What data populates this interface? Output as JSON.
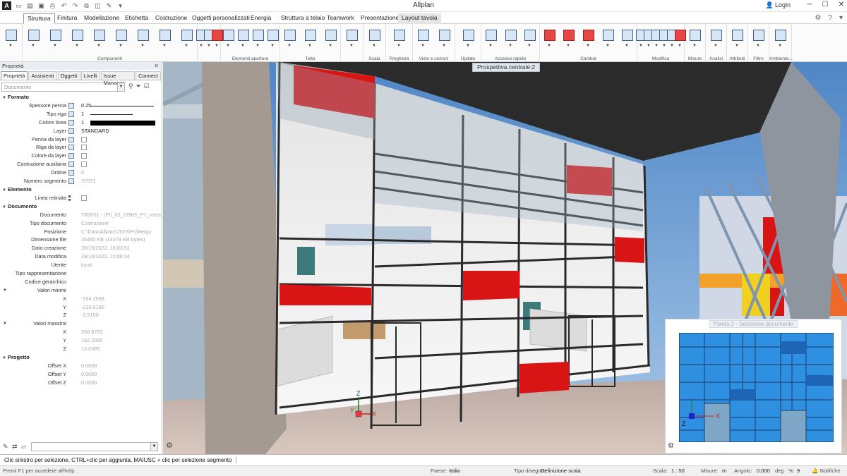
{
  "app": {
    "title": "Allplan",
    "logo": "A",
    "login": "Login"
  },
  "tabs": [
    {
      "label": "Struttura",
      "active": true
    },
    {
      "label": "Finitura"
    },
    {
      "label": "Modellazione"
    },
    {
      "label": "Etichetta"
    },
    {
      "label": "Costruzione"
    },
    {
      "label": "Oggetti personalizzati"
    },
    {
      "label": "Energia"
    },
    {
      "label": "Struttura a telaio"
    },
    {
      "label": "Teamwork"
    },
    {
      "label": "Presentazione"
    },
    {
      "label": "Layout tavola"
    }
  ],
  "ribbon_groups": [
    {
      "label": "",
      "icons": [
        "layers-icon"
      ]
    },
    {
      "label": "Componenti",
      "icons": [
        "wall-icon",
        "slab-icon",
        "beam-icon",
        "column-icon",
        "foundation-icon",
        "stair-icon",
        "beam-frame-icon",
        "column-frame-icon"
      ]
    },
    {
      "label": "",
      "icons": [
        "room-icon",
        "bar-chart-icon",
        "delete-red-icon"
      ]
    },
    {
      "label": "Elementi apertura",
      "icons": [
        "window-icon",
        "door-icon",
        "opening-icon",
        "niche-icon"
      ]
    },
    {
      "label": "Tetto",
      "icons": [
        "roof-icon",
        "roof2-icon",
        "roof3-icon"
      ]
    },
    {
      "label": "",
      "icons": [
        "roof-edit-icon"
      ]
    },
    {
      "label": "Scala",
      "icons": [
        "stair2-icon"
      ]
    },
    {
      "label": "Ringhiera",
      "icons": [
        "railing-icon"
      ]
    },
    {
      "label": "Viste e sezioni",
      "icons": [
        "house-view-icon",
        "section-icon"
      ]
    },
    {
      "label": "Update",
      "icons": [
        "update-icon"
      ]
    },
    {
      "label": "Accesso rapido",
      "icons": [
        "line-icon",
        "text-icon",
        "dimension-icon"
      ]
    },
    {
      "label": "Cambia",
      "icons": [
        "pencil-icon",
        "modify-icon",
        "stretch-icon",
        "convert-icon",
        "replace-icon"
      ]
    },
    {
      "label": "Modifica",
      "icons": [
        "copy-icon",
        "move-icon",
        "rotate-icon",
        "mirror-icon",
        "scale-icon",
        "delete-icon"
      ]
    },
    {
      "label": "Misure",
      "icons": [
        "measure-icon"
      ]
    },
    {
      "label": "Analisi",
      "icons": [
        "abc-icon"
      ]
    },
    {
      "label": "Attributi",
      "icons": [
        "attributes-icon"
      ]
    },
    {
      "label": "Filtro",
      "icons": [
        "filter-icon"
      ]
    },
    {
      "label": "Ambiente...",
      "icons": [
        "environment-icon"
      ]
    }
  ],
  "panel": {
    "title": "Proprietà",
    "tabs": [
      "Proprietà",
      "Assistenti",
      "Oggetti",
      "Livelli",
      "Issue Manager",
      "Connect"
    ],
    "doc_placeholder": "Documento",
    "sections": {
      "formato": {
        "title": "Formato",
        "rows": [
          {
            "label": "Spessore penna",
            "value": "0.25"
          },
          {
            "label": "Tipo riga",
            "value": "1"
          },
          {
            "label": "Colore linea",
            "value": "1"
          },
          {
            "label": "Layer",
            "value": "STANDARD"
          },
          {
            "label": "Penna da layer"
          },
          {
            "label": "Riga da layer"
          },
          {
            "label": "Colore da layer"
          },
          {
            "label": "Costruzione ausiliaria"
          },
          {
            "label": "Ordine",
            "value": "0"
          },
          {
            "label": "Numero segmento",
            "value": "37071"
          }
        ]
      },
      "elemento": {
        "title": "Elemento",
        "rows": [
          {
            "label": "Linea retinata"
          }
        ]
      },
      "documento": {
        "title": "Documento",
        "rows": [
          {
            "label": "Documento",
            "value": "TB3001 - (P0_03_07BIS_P1_vetra"
          },
          {
            "label": "Tipo documento",
            "value": "Costruzione"
          },
          {
            "label": "Posizione",
            "value": "C:\\Data\\Allplan\\2023\\Prj\\Bergo"
          },
          {
            "label": "Dimensione file",
            "value": "35485 KB (14379 KB bytes)"
          },
          {
            "label": "Data creazione",
            "value": "28/10/2022, 15:03:51"
          },
          {
            "label": "Data modifica",
            "value": "28/10/2022, 15:08:34"
          },
          {
            "label": "Utente",
            "value": "local"
          },
          {
            "label": "Tipo rappresentazione",
            "value": ""
          },
          {
            "label": "Codice gerarchico",
            "value": ""
          },
          {
            "label": "Valori minimi",
            "value": ""
          },
          {
            "label": "X",
            "value": "-194.2938"
          },
          {
            "label": "Y",
            "value": "-210.0190"
          },
          {
            "label": "Z",
            "value": "-3.5100"
          },
          {
            "label": "Valori massimi",
            "value": ""
          },
          {
            "label": "X",
            "value": "258.8783"
          },
          {
            "label": "Y",
            "value": "192.2080"
          },
          {
            "label": "Z",
            "value": "13.0385"
          }
        ]
      },
      "progetto": {
        "title": "Progetto",
        "rows": [
          {
            "label": "Offset X",
            "value": "0.0000"
          },
          {
            "label": "Offset Y",
            "value": "0.0000"
          },
          {
            "label": "Offset Z",
            "value": "0.0000"
          }
        ]
      }
    }
  },
  "viewport": {
    "label": "Prospettiva centrale:2",
    "axes": {
      "x": "X",
      "y": "Y",
      "z": "Z"
    },
    "minimap": {
      "label": "Pianta:1 - Selezione documento"
    }
  },
  "hint": "Clic sinistro per selezione, CTRL+clic per aggiunta, MAIUSC + clic per selezione segmento",
  "status": {
    "help": "Premi F1 per accedere all'help.",
    "paese_label": "Paese:",
    "paese": "Italia",
    "tipo_label": "Tipo disegno:",
    "tipo": "Definizione scala",
    "scala_label": "Scala:",
    "scala": "1 : 50",
    "misure_label": "Misure:",
    "misure": "m",
    "angolo_label": "Angolo:",
    "angolo": "0.000",
    "angolo_unit": "deg",
    "pct_label": "%:",
    "pct": "9",
    "notifiche": "Notifiche"
  },
  "colors": {
    "accent": "#2f8fe0",
    "red": "#d91414",
    "sky": "#4e8ccc"
  }
}
